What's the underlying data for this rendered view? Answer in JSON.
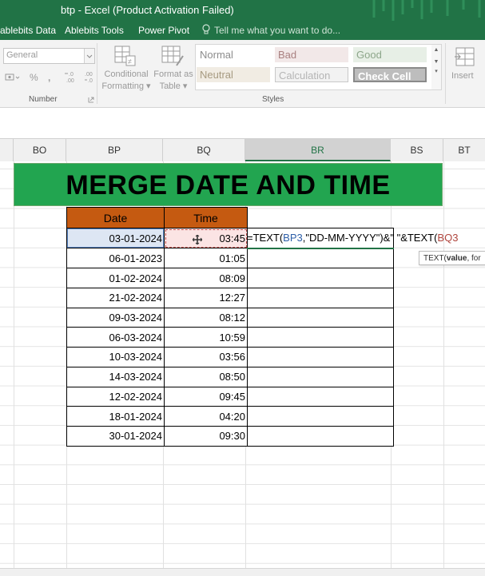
{
  "window": {
    "title": "btp - Excel (Product Activation Failed)"
  },
  "ribbon_tabs": [
    "ablebits Data",
    "Ablebits Tools",
    "Power Pivot"
  ],
  "tell_me": {
    "placeholder": "Tell me what you want to do..."
  },
  "ribbon": {
    "number_group": {
      "format_value": "General",
      "percent": "%",
      "comma": ",",
      "increase_decimal": "←.0\n.00",
      "decrease_decimal": ".00\n→.0",
      "label": "Number"
    },
    "conditional_formatting": {
      "line1": "Conditional",
      "line2": "Formatting ▾"
    },
    "format_as_table": {
      "line1": "Format as",
      "line2": "Table ▾"
    },
    "styles": {
      "label": "Styles",
      "items": [
        {
          "label": "Normal",
          "bg": "#ffffff",
          "color": "#8c8c8c"
        },
        {
          "label": "Bad",
          "bg": "#f2e8e8",
          "color": "#a98080"
        },
        {
          "label": "Good",
          "bg": "#e7efe6",
          "color": "#8da68a"
        },
        {
          "label": "Neutral",
          "bg": "#f1ece3",
          "color": "#a69a80"
        },
        {
          "label": "Calculation",
          "bg": "#f2f2f2",
          "color": "#b5b5b5"
        },
        {
          "label": "Check Cell",
          "bg": "#bdbdbd",
          "color": "#ffffff"
        }
      ]
    },
    "insert": {
      "label": "Insert"
    }
  },
  "columns": [
    "BO",
    "BP",
    "BQ",
    "BR",
    "BS",
    "BT"
  ],
  "banner": {
    "title": "MERGE DATE AND TIME"
  },
  "table": {
    "headers": [
      "Date",
      "Time"
    ],
    "rows": [
      {
        "date": "03-01-2024",
        "time": "03:45"
      },
      {
        "date": "06-01-2023",
        "time": "01:05"
      },
      {
        "date": "01-02-2024",
        "time": "08:09"
      },
      {
        "date": "21-02-2024",
        "time": "12:27"
      },
      {
        "date": "09-03-2024",
        "time": "08:12"
      },
      {
        "date": "06-03-2024",
        "time": "10:59"
      },
      {
        "date": "10-03-2024",
        "time": "03:56"
      },
      {
        "date": "14-03-2024",
        "time": "08:50"
      },
      {
        "date": "12-02-2024",
        "time": "09:45"
      },
      {
        "date": "18-01-2024",
        "time": "04:20"
      },
      {
        "date": "30-01-2024",
        "time": "09:30"
      }
    ]
  },
  "formula": {
    "part1": "=TEXT(",
    "ref1": "BP3",
    "part2": ",\"DD-MM-YYYY\")&\"  \"&TEXT(",
    "ref2": "BQ3"
  },
  "tooltip": {
    "fn": "TEXT(",
    "arg": "value",
    "rest": ", for"
  },
  "colors": {
    "excel_green": "#217346",
    "banner_green": "#22a550",
    "header_orange": "#c55a11"
  }
}
